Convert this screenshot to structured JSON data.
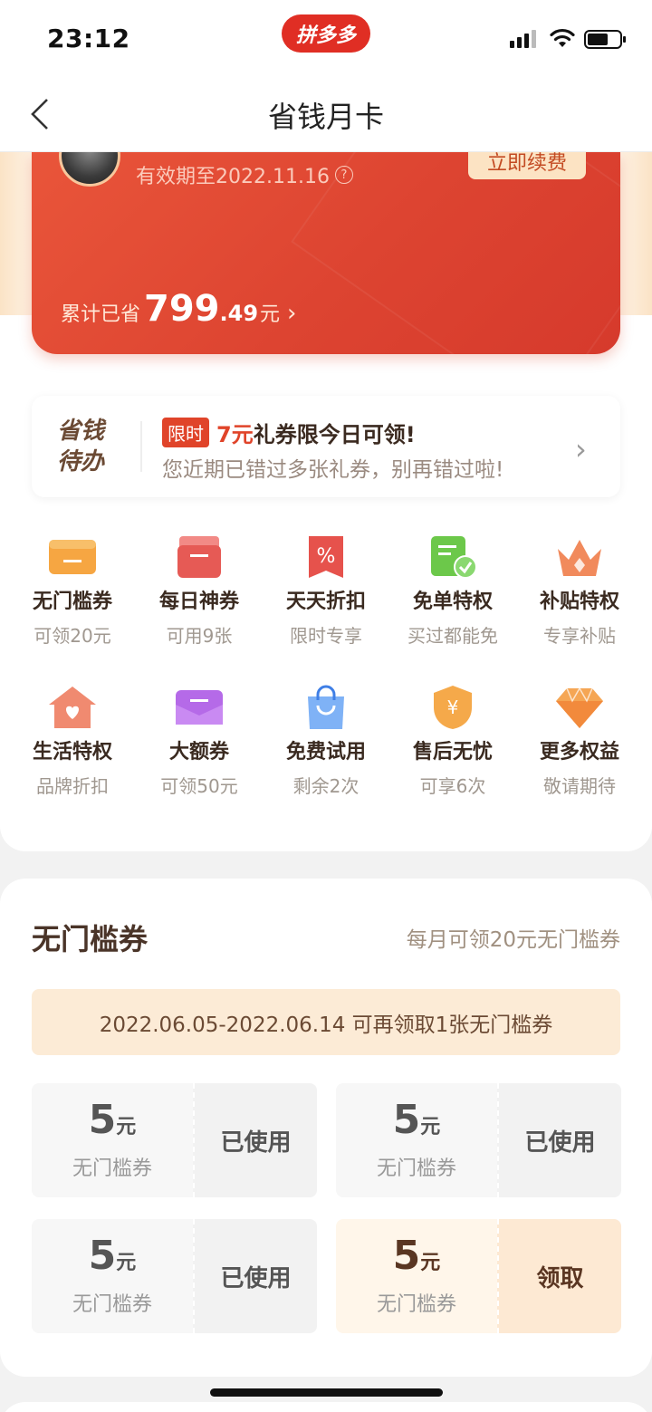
{
  "status_bar": {
    "time": "23:12",
    "app_badge": "拼多多"
  },
  "nav": {
    "title": "省钱月卡"
  },
  "card": {
    "expiry": "有效期至2022.11.16",
    "renew_label": "立即续费",
    "saved_label": "累计已省",
    "saved_int": "799",
    "saved_dec": ".49",
    "saved_unit": "元"
  },
  "todo": {
    "title": "省钱待办",
    "tag": "限时",
    "highlight": "7元",
    "headline_rest": "礼券限今日可领!",
    "subline": "您近期已错过多张礼券，别再错过啦!"
  },
  "benefits": [
    {
      "title": "无门槛券",
      "sub": "可领20元",
      "icon": "ticket-icon"
    },
    {
      "title": "每日神券",
      "sub": "可用9张",
      "icon": "coupon-pack-icon"
    },
    {
      "title": "天天折扣",
      "sub": "限时专享",
      "icon": "percent-icon"
    },
    {
      "title": "免单特权",
      "sub": "买过都能免",
      "icon": "check-doc-icon"
    },
    {
      "title": "补贴特权",
      "sub": "专享补贴",
      "icon": "crown-icon"
    },
    {
      "title": "生活特权",
      "sub": "品牌折扣",
      "icon": "house-heart-icon"
    },
    {
      "title": "大额券",
      "sub": "可领50元",
      "icon": "envelope-icon"
    },
    {
      "title": "免费试用",
      "sub": "剩余2次",
      "icon": "shopping-bag-icon"
    },
    {
      "title": "售后无忧",
      "sub": "可享6次",
      "icon": "shield-yen-icon"
    },
    {
      "title": "更多权益",
      "sub": "敬请期待",
      "icon": "diamond-icon"
    }
  ],
  "coupons_section": {
    "title": "无门槛券",
    "subtitle": "每月可领20元无门槛券",
    "banner": "2022.06.05-2022.06.14 可再领取1张无门槛券",
    "coupons": [
      {
        "amount": "5",
        "unit": "元",
        "label": "无门槛券",
        "action": "已使用"
      },
      {
        "amount": "5",
        "unit": "元",
        "label": "无门槛券",
        "action": "已使用"
      },
      {
        "amount": "5",
        "unit": "元",
        "label": "无门槛券",
        "action": "已使用"
      },
      {
        "amount": "5",
        "unit": "元",
        "label": "无门槛券",
        "action": "领取"
      }
    ]
  },
  "colors": {
    "brand_red": "#e0442a",
    "card_red": "#dd4431",
    "gold": "#fce3c3"
  }
}
